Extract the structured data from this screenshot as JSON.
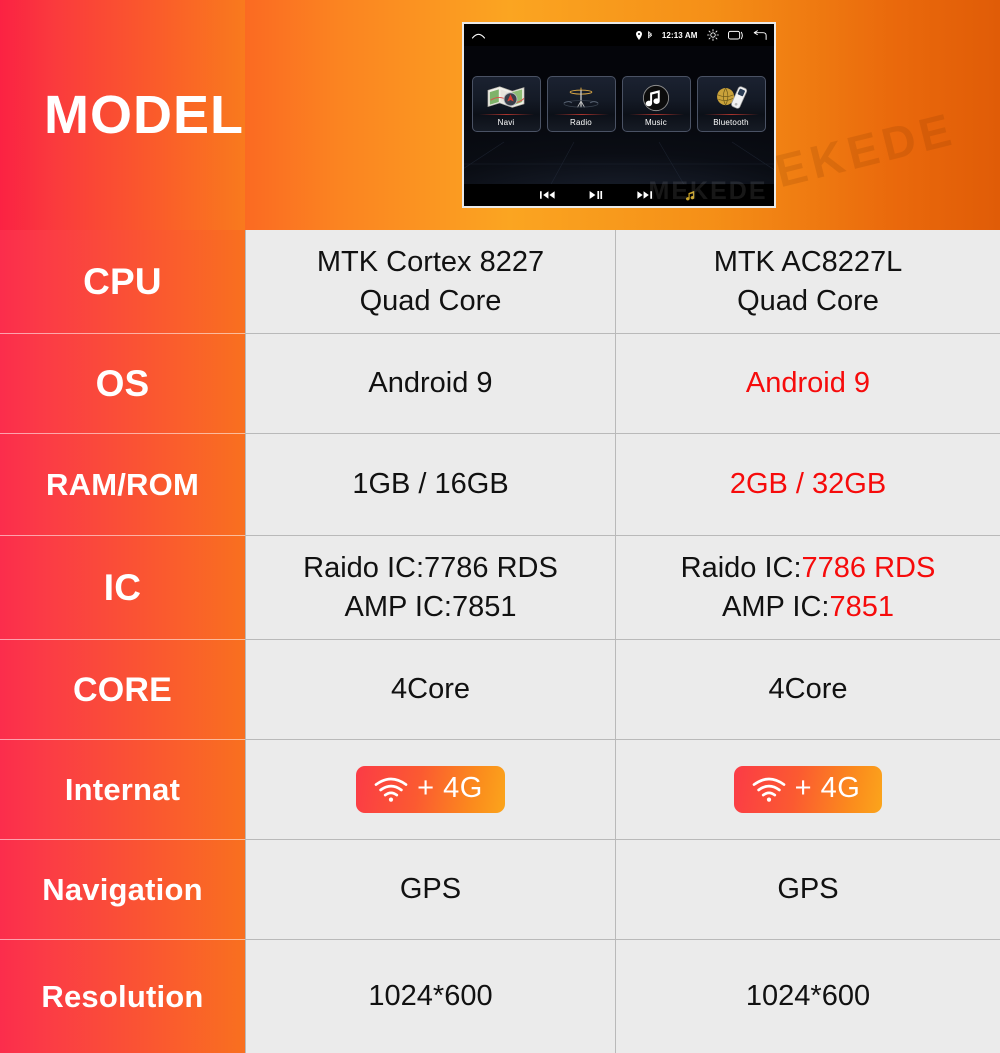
{
  "header": {
    "label": "MODEL",
    "watermark": "MEKEDE",
    "device": {
      "status_bar": {
        "home_icon": "home-icon",
        "location_icon": "location-pin-icon",
        "bluetooth_icon": "bluetooth-icon",
        "time": "12:13 AM",
        "brightness_icon": "brightness-sun-icon",
        "recents_icon": "recents-square-icon",
        "back_icon": "back-arrow-icon"
      },
      "apps": [
        {
          "name": "Navi",
          "icon": "map-navigation-icon"
        },
        {
          "name": "Radio",
          "icon": "radio-tower-icon"
        },
        {
          "name": "Music",
          "icon": "music-note-icon"
        },
        {
          "name": "Bluetooth",
          "icon": "bluetooth-phone-icon"
        }
      ],
      "playback": {
        "previous_icon": "skip-previous-icon",
        "play_pause_icon": "play-pause-icon",
        "next_icon": "skip-next-icon",
        "music_icon": "music-note-small-icon"
      },
      "watermark": "MEKEDE"
    }
  },
  "columns": {
    "label_header": "MODEL",
    "product_a": "",
    "product_b": ""
  },
  "rows": [
    {
      "label": "CPU",
      "label_size": "sz-xl",
      "a": [
        {
          "text": "MTK Cortex 8227",
          "red": false
        },
        {
          "text": "Quad Core",
          "red": false
        }
      ],
      "b": [
        {
          "text": "MTK AC8227L",
          "red": false
        },
        {
          "text": "Quad Core",
          "red": false
        }
      ]
    },
    {
      "label": "OS",
      "label_size": "sz-xl",
      "a": [
        {
          "text": "Android 9",
          "red": false
        }
      ],
      "b": [
        {
          "text": "Android 9",
          "red": true
        }
      ]
    },
    {
      "label": "RAM/ROM",
      "label_size": "sz-md",
      "a": [
        {
          "text": "1GB / 16GB",
          "red": false
        }
      ],
      "b": [
        {
          "text": "2GB / 32GB",
          "red": true
        }
      ]
    },
    {
      "label": "IC",
      "label_size": "sz-xl",
      "a": [
        {
          "text": "Raido IC:7786 RDS",
          "red": false
        },
        {
          "text": "AMP IC:7851",
          "red": false
        }
      ],
      "b": [
        {
          "prefix": "Raido IC:",
          "value": "7786 RDS",
          "split": true
        },
        {
          "prefix": "AMP IC:",
          "value": "7851",
          "split": true
        }
      ]
    },
    {
      "label": "CORE",
      "label_size": "sz-lg",
      "a": [
        {
          "text": "4Core",
          "red": false
        }
      ],
      "b": [
        {
          "text": "4Core",
          "red": false
        }
      ]
    },
    {
      "label": "Internat",
      "label_size": "sz-md",
      "badge": true,
      "badge_text": "+ 4G",
      "badge_icon": "wifi-icon"
    },
    {
      "label": "Navigation",
      "label_size": "sz-md",
      "a": [
        {
          "text": "GPS",
          "red": false
        }
      ],
      "b": [
        {
          "text": "GPS",
          "red": false
        }
      ]
    },
    {
      "label": "Resolution",
      "label_size": "sz-md",
      "a": [
        {
          "text": "1024*600",
          "red": false
        }
      ],
      "b": [
        {
          "text": "1024*600",
          "red": false
        }
      ]
    }
  ],
  "colors": {
    "label_gradient_start": "#fb2d4c",
    "label_gradient_end": "#f9701f",
    "value_background": "#ebebeb",
    "highlight_red": "#f60b0b",
    "grid_line": "#b9b9b9"
  }
}
